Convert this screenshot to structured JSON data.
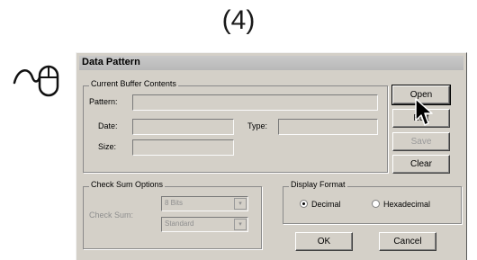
{
  "step_label": "(4)",
  "dialog": {
    "title": "Data Pattern",
    "buffer_group": {
      "legend": "Current Buffer Contents",
      "pattern_label": "Pattern:",
      "pattern_value": "",
      "date_label": "Date:",
      "date_value": "",
      "type_label": "Type:",
      "type_value": "",
      "size_label": "Size:",
      "size_value": ""
    },
    "checksum_group": {
      "legend": "Check Sum Options",
      "label": "Check Sum:",
      "select1_value": "8 Bits",
      "select2_value": "Standard"
    },
    "display_group": {
      "legend": "Display Format",
      "options": [
        "Decimal",
        "Hexadecimal"
      ],
      "selected": "Decimal"
    },
    "buttons": {
      "open": "Open",
      "edit": "Edit",
      "save": "Save",
      "clear": "Clear",
      "ok": "OK",
      "cancel": "Cancel"
    }
  },
  "icons": [
    "mouse-click-icon",
    "arrow-cursor-icon"
  ]
}
